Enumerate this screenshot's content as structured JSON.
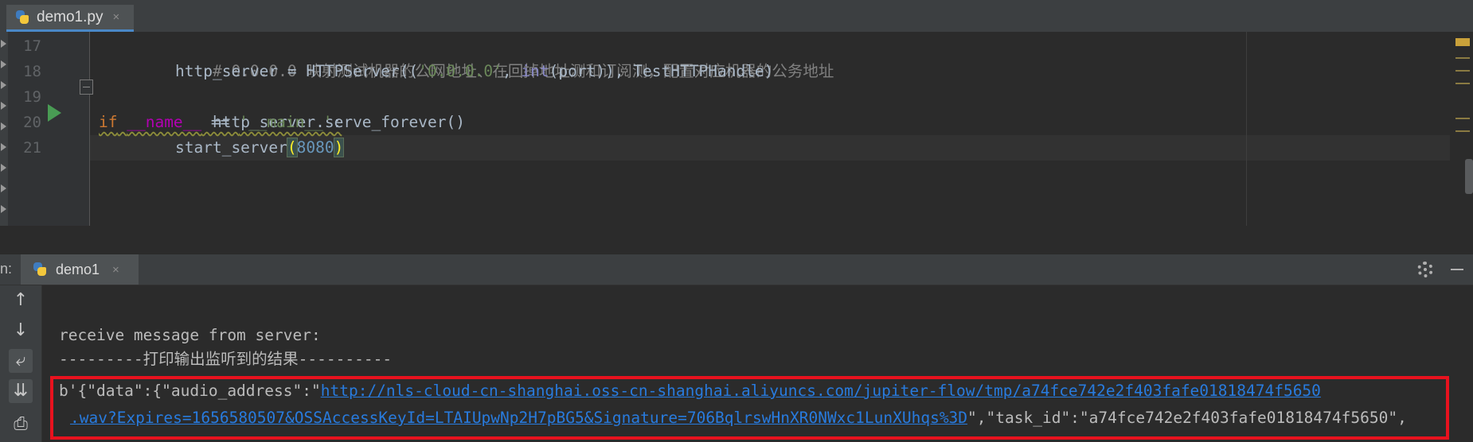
{
  "editor": {
    "tab": {
      "filename": "demo1.py",
      "close": "×"
    },
    "line_numbers": [
      "17",
      "18",
      "19",
      "20",
      "21"
    ],
    "code": {
      "l17_comment": "# 0.0.0.0 映射测试机器的公网地址、在回掉地址测和订阅测，配置对应机器的公务地址",
      "l18_a": "http_server = HTTPServer((",
      "l18_str": "'0.0.0.0'",
      "l18_b": ", ",
      "l18_builtin": "int",
      "l18_c": "(port)), TestHTTPHandle)",
      "l19": "http_server.serve_forever()",
      "l20_kw": "if",
      "l20_sp": " ",
      "l20_magic": "__name__",
      "l20_op": " == ",
      "l20_str": "'__main__'",
      "l20_colon": ":",
      "l21_a": "start_server",
      "l21_open": "(",
      "l21_num": "8080",
      "l21_close": ")"
    }
  },
  "run_panel": {
    "prefix": "n:",
    "tab": {
      "label": "demo1",
      "close": "×"
    },
    "toolbar": {
      "up": "↑",
      "down": "↓",
      "soft_wrap": "⤶",
      "scroll_end": "⇊",
      "print": "⎙"
    },
    "console": {
      "line1": "receive message from server:",
      "line2": "---------打印输出监听到的结果----------",
      "line3_prefix": "b'{\"data\":{\"audio_address\":\"",
      "line3_link": "http://nls-cloud-cn-shanghai.oss-cn-shanghai.aliyuncs.com/jupiter-flow/tmp/a74fce742e2f403fafe01818474f5650",
      "line4_link": ".wav?Expires=1656580507&OSSAccessKeyId=LTAIUpwNp2H7pBG5&Signature=706BqlrswHnXR0NWxc1LunXUhqs%3D",
      "line4_suffix": "\",\"task_id\":\"a74fce742e2f403fafe01818474f5650\","
    }
  },
  "colors": {
    "keyword": "#cc7832",
    "string": "#6a8759",
    "number": "#6897bb",
    "link": "#287bde",
    "highlight_box": "#e8121e"
  }
}
